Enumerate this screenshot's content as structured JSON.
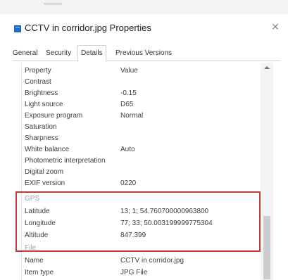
{
  "window": {
    "title": "CCTV in corridor.jpg Properties",
    "close_glyph": "✕"
  },
  "tabs": [
    {
      "label": "General"
    },
    {
      "label": "Security"
    },
    {
      "label": "Details"
    },
    {
      "label": "Previous Versions"
    }
  ],
  "active_tab": "Details",
  "header": {
    "property": "Property",
    "value": "Value"
  },
  "rows": [
    {
      "key": "Contrast",
      "value": ""
    },
    {
      "key": "Brightness",
      "value": "-0.15"
    },
    {
      "key": "Light source",
      "value": "D65"
    },
    {
      "key": "Exposure program",
      "value": "Normal"
    },
    {
      "key": "Saturation",
      "value": ""
    },
    {
      "key": "Sharpness",
      "value": ""
    },
    {
      "key": "White balance",
      "value": "Auto"
    },
    {
      "key": "Photometric interpretation",
      "value": ""
    },
    {
      "key": "Digital zoom",
      "value": ""
    },
    {
      "key": "EXIF version",
      "value": "0220"
    }
  ],
  "gps": {
    "section_label": "GPS",
    "rows": [
      {
        "key": "Latitude",
        "value": "13; 1; 54.760700000963800"
      },
      {
        "key": "Longitude",
        "value": "77; 33; 50.003199999775304"
      },
      {
        "key": "Altitude",
        "value": "847.399"
      }
    ]
  },
  "file": {
    "section_label": "File",
    "rows": [
      {
        "key": "Name",
        "value": "CCTV in corridor.jpg"
      },
      {
        "key": "Item type",
        "value": "JPG File"
      }
    ]
  },
  "icons": {
    "app": "properties-icon",
    "close": "close-icon",
    "scroll_up": "scroll-up-arrow-icon"
  },
  "colors": {
    "highlight": "#c43b3b",
    "accent": "#1e6fd0"
  }
}
